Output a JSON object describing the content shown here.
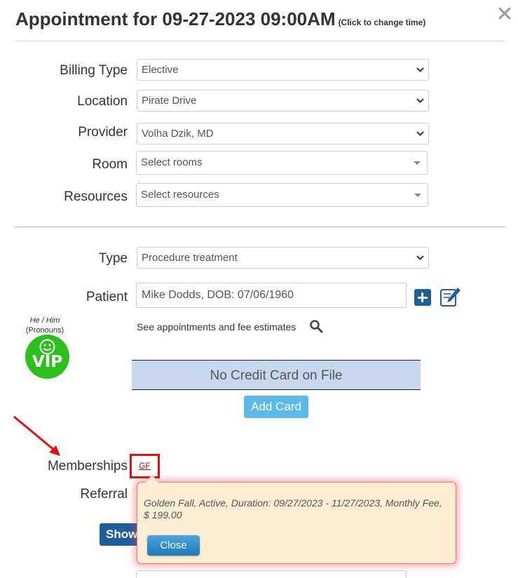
{
  "header": {
    "title": "Appointment for 09-27-2023 09:00AM",
    "title_hint": "(Click to change time)",
    "close_symbol": "✕"
  },
  "form": {
    "billing_type": {
      "label": "Billing Type",
      "value": "Elective"
    },
    "location": {
      "label": "Location",
      "value": "Pirate Drive"
    },
    "provider": {
      "label": "Provider",
      "value": "Volha Dzik, MD"
    },
    "room": {
      "label": "Room",
      "placeholder": "Select rooms"
    },
    "resources": {
      "label": "Resources",
      "placeholder": "Select resources"
    },
    "type": {
      "label": "Type",
      "value": "Procedure treatment"
    },
    "patient": {
      "label": "Patient",
      "value": "Mike Dodds, DOB: 07/06/1960"
    },
    "see_appointments": "See appointments and fee estimates",
    "memberships_label": "Memberships",
    "membership_code": "GF",
    "referral_label": "Referral",
    "show_button": "Show"
  },
  "patient_badge": {
    "pronouns": "He / Him",
    "pronouns_caption": "(Pronouns)",
    "vip_label": "VIP",
    "vip_color": "#2dc01c"
  },
  "credit_card": {
    "status": "No Credit Card on File",
    "add_button": "Add Card"
  },
  "popover": {
    "text": "Golden Fall, Active, Duration: 09/27/2023 - 11/27/2023, Monthly Fee, $ 199.00",
    "close_button": "Close"
  },
  "colors": {
    "primary_blue": "#1e5f9a",
    "light_blue_button": "#5bbbe6",
    "card_box_bg": "#c8d8ee",
    "highlight_red": "#e01010",
    "popover_bg": "#fdedd4"
  },
  "icons": {
    "close": "close-icon",
    "chevron": "chevron-down-icon",
    "plus": "plus-icon",
    "edit": "edit-icon",
    "search": "search-icon",
    "smile": "smiley-icon",
    "arrow": "red-arrow-icon"
  }
}
